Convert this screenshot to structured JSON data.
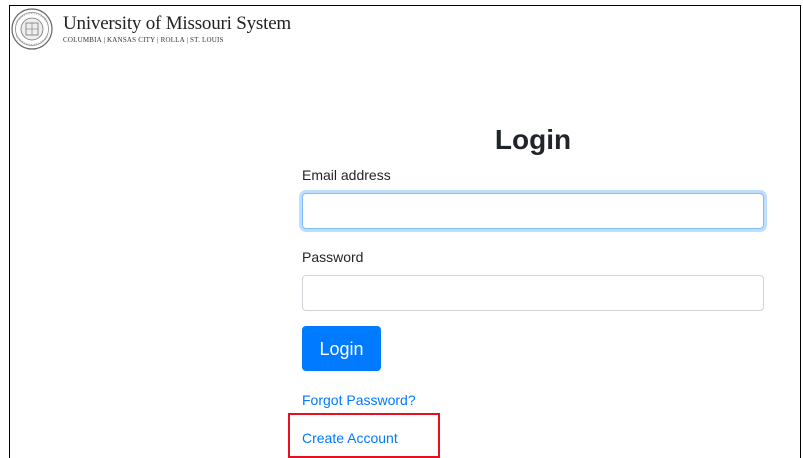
{
  "header": {
    "title": "University of Missouri System",
    "subtitle": "COLUMBIA | KANSAS CITY | ROLLA | ST. LOUIS",
    "seal_icon": "university-seal-icon"
  },
  "form": {
    "title": "Login",
    "email_label": "Email address",
    "email_value": "",
    "password_label": "Password",
    "password_value": "",
    "login_button": "Login",
    "forgot_link": "Forgot Password?",
    "create_link": "Create Account"
  },
  "colors": {
    "primary": "#007bff",
    "highlight": "#e8101e"
  }
}
